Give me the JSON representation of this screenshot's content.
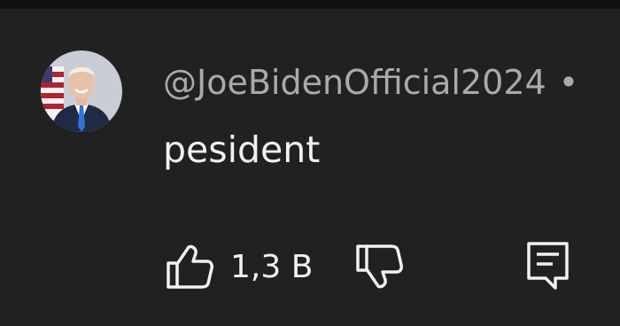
{
  "comment": {
    "author": "@JoeBidenOfficial2024",
    "separator": "•",
    "text": "pesident",
    "like_count": "1,3 B"
  },
  "icons": {
    "like": "thumbs-up-icon",
    "dislike": "thumbs-down-icon",
    "reply": "reply-comment-icon",
    "avatar": "profile-photo"
  },
  "colors": {
    "background": "#212121",
    "top_bar": "#111111",
    "author_text": "#aaaaaa",
    "body_text": "#f1f1f1",
    "icon_stroke": "#f1f1f1"
  }
}
